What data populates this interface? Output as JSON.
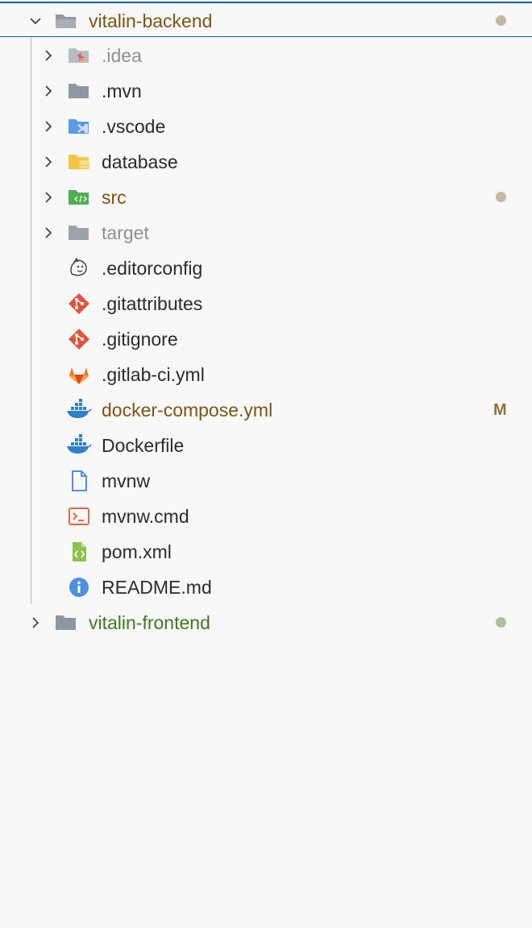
{
  "explorer": {
    "root_folder": {
      "label": "vitalin-backend",
      "status_color": "#c6b79f"
    },
    "children": {
      "idea": {
        "label": ".idea",
        "icon": "idea-folder-icon"
      },
      "mvn": {
        "label": ".mvn",
        "icon": "folder-icon"
      },
      "vscode": {
        "label": ".vscode",
        "icon": "vscode-folder-icon"
      },
      "database": {
        "label": "database",
        "icon": "database-folder-icon"
      },
      "src": {
        "label": "src",
        "icon": "src-folder-icon",
        "status_color": "#c6b79f"
      },
      "target": {
        "label": "target",
        "icon": "folder-icon"
      },
      "editorconfig": {
        "label": ".editorconfig",
        "icon": "editorconfig-icon"
      },
      "gitattributes": {
        "label": ".gitattributes",
        "icon": "git-icon"
      },
      "gitignore": {
        "label": ".gitignore",
        "icon": "git-icon"
      },
      "gitlab_ci": {
        "label": ".gitlab-ci.yml",
        "icon": "gitlab-icon"
      },
      "docker_compose": {
        "label": "docker-compose.yml",
        "icon": "docker-icon",
        "badge": "M"
      },
      "dockerfile": {
        "label": "Dockerfile",
        "icon": "docker-icon"
      },
      "mvnw": {
        "label": "mvnw",
        "icon": "file-icon"
      },
      "mvnw_cmd": {
        "label": "mvnw.cmd",
        "icon": "terminal-icon"
      },
      "pom": {
        "label": "pom.xml",
        "icon": "xml-icon"
      },
      "readme": {
        "label": "README.md",
        "icon": "info-icon"
      }
    },
    "second_folder": {
      "label": "vitalin-frontend",
      "status_color": "#a9c59e"
    }
  },
  "colors": {
    "selection_border": "#0a5fb8",
    "modified_text": "#7d5410",
    "untracked_text": "#3b7a22",
    "ignored_text": "#8f8f8f",
    "background": "#f8f8f8"
  }
}
